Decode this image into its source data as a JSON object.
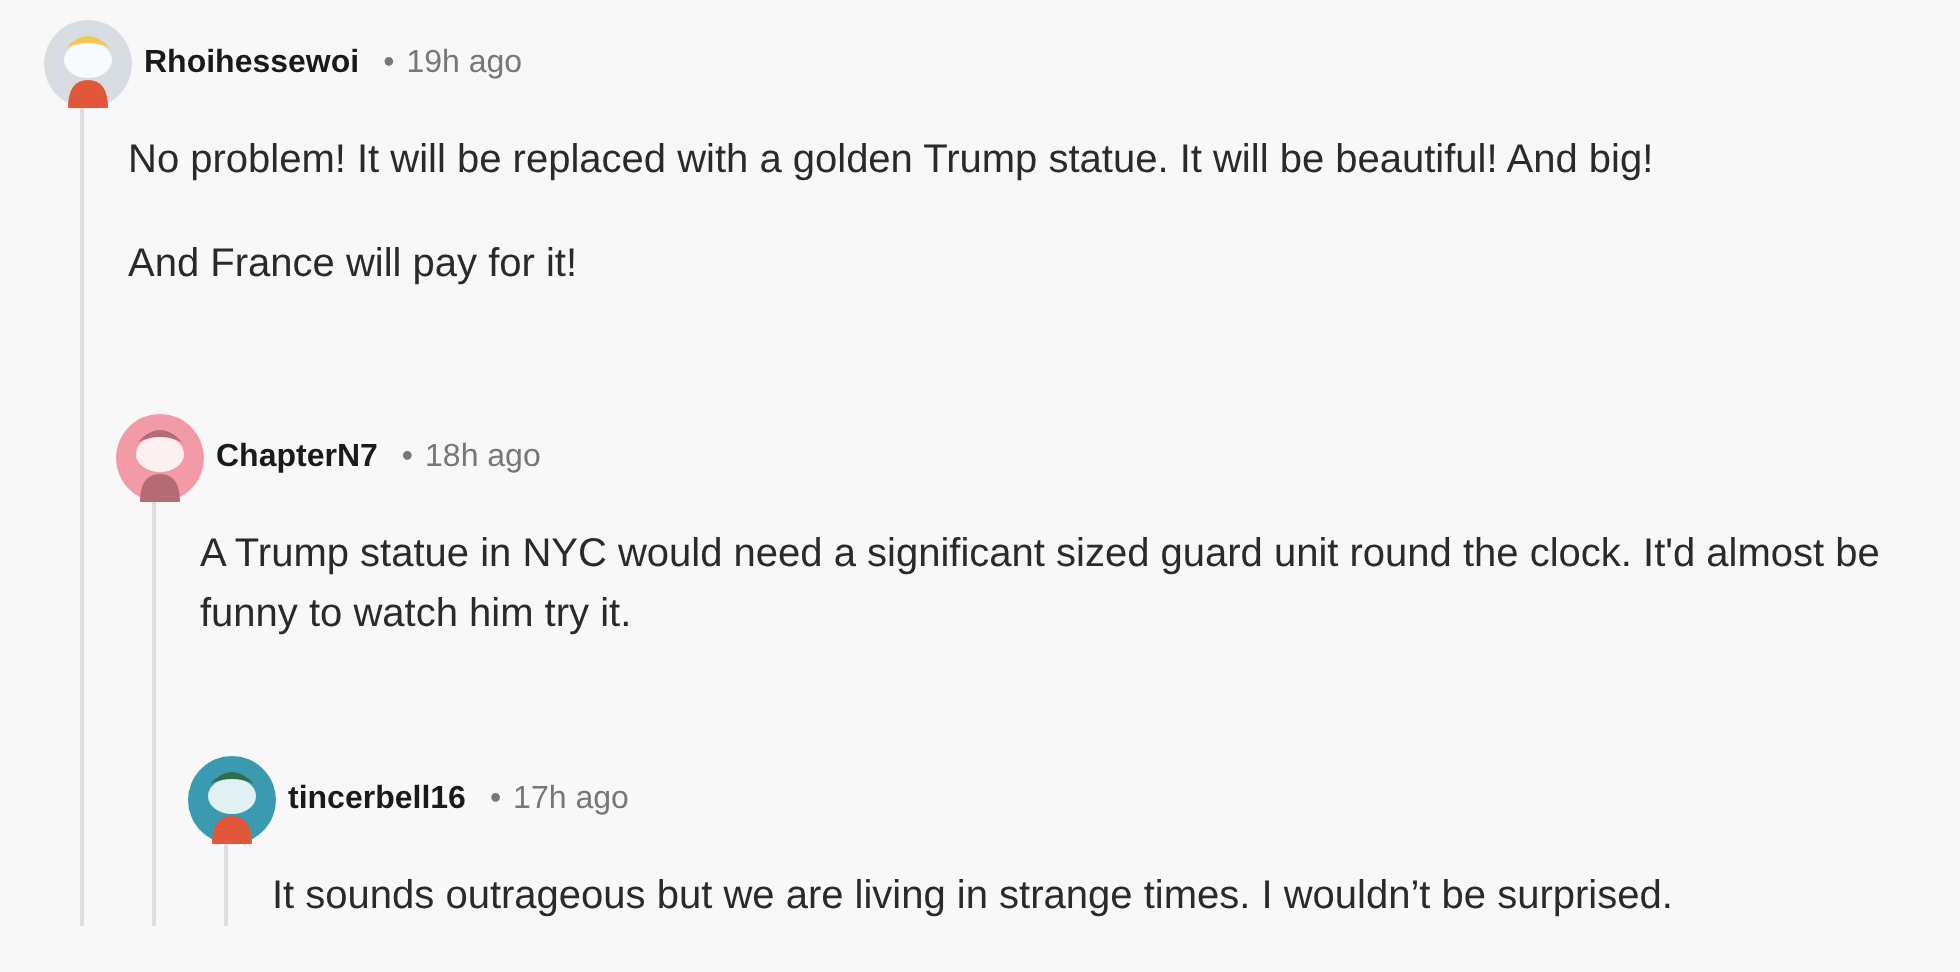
{
  "comments": [
    {
      "author": "Rhoihessewoi",
      "separator": "•",
      "time": "19h ago",
      "paragraphs": [
        "No problem! It will be replaced with a golden Trump statue. It will be beautiful! And big!",
        "And France will pay for it!"
      ],
      "children": [
        {
          "author": "ChapterN7",
          "separator": "•",
          "time": "18h ago",
          "paragraphs": [
            "A Trump statue in NYC would need a significant sized guard unit round the clock. It'd almost be funny to watch him try it."
          ],
          "children": [
            {
              "author": "tincerbell16",
              "separator": "•",
              "time": "17h ago",
              "paragraphs": [
                "It sounds outrageous but we are living in strange times. I wouldn’t be surprised."
              ]
            }
          ]
        }
      ]
    }
  ]
}
